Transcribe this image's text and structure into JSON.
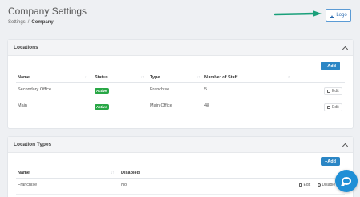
{
  "header": {
    "title": "Company Settings",
    "logo_button": "Logo"
  },
  "breadcrumb": {
    "items": [
      "Settings",
      "Company"
    ],
    "separator": "/"
  },
  "icons": {
    "logo": "image-icon",
    "collapse": "chevron-up-icon",
    "add": "plus-icon",
    "edit": "edit-icon",
    "disable": "ban-icon",
    "chat": "chat-icon",
    "arrow": "arrow-right-icon"
  },
  "colors": {
    "arrow": "#1aa07a",
    "add_button": "#2b86c5",
    "active_badge": "#28a745",
    "chat": "#1f8fd6",
    "logo_button_border": "#5b9bd5"
  },
  "locations": {
    "title": "Locations",
    "add_label": "Add",
    "columns": [
      "Name",
      "Status",
      "Type",
      "Number of Staff",
      "↓↑"
    ],
    "rows": [
      {
        "name": "Secondary Office",
        "status": "Active",
        "type": "Franchise",
        "staff": "5",
        "action": "Edit"
      },
      {
        "name": "Main",
        "status": "Active",
        "type": "Main Office",
        "staff": "48",
        "action": "Edit"
      }
    ]
  },
  "location_types": {
    "title": "Location Types",
    "add_label": "Add",
    "columns": [
      "Name",
      "Disabled"
    ],
    "rows": [
      {
        "name": "Franchise",
        "disabled": "No",
        "edit": "Edit",
        "disable": "Disable"
      }
    ]
  }
}
